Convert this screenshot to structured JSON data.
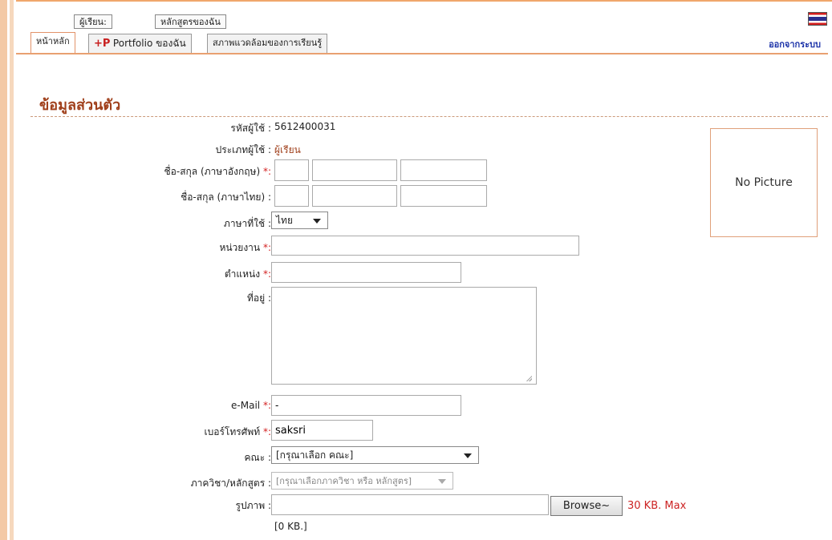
{
  "nav": {
    "learner_btn": "ผู้เรียน:",
    "my_courses_btn": "หลักสูตรของฉัน",
    "tabs": [
      {
        "label": "หน้าหลัก"
      },
      {
        "prefix": "+P",
        "label": "Portfolio ของฉัน"
      },
      {
        "label": "สภาพแวดล้อมของการเรียนรู้"
      }
    ],
    "logout": "ออกจากระบบ"
  },
  "section_title": "ข้อมูลส่วนตัว",
  "form": {
    "user_id_label": "รหัสผู้ใช้ :",
    "user_id_value": "5612400031",
    "user_type_label": "ประเภทผู้ใช้ :",
    "user_type_value": "ผู้เรียน",
    "name_en_label": "ชื่อ-สกุล (ภาษาอังกฤษ)",
    "name_th_label": "ชื่อ-สกุล (ภาษาไทย) :",
    "language_label": "ภาษาที่ใช้ :",
    "language_value": "ไทย",
    "org_label": "หน่วยงาน",
    "position_label": "ตำแหน่ง",
    "address_label": "ที่อยู่ :",
    "email_label": "e-Mail",
    "email_value": "-",
    "phone_label": "เบอร์โทรศัพท์",
    "phone_value": "saksri",
    "faculty_label": "คณะ :",
    "faculty_value": "[กรุณาเลือก คณะ]",
    "dept_label": "ภาควิชา/หลักสูตร :",
    "dept_value": "[กรุณาเลือกภาควิชา หรือ หลักสูตร]",
    "photo_label": "รูปภาพ :",
    "browse_label": "Browse~",
    "max_size": "30 KB. Max",
    "file_size": "[0 KB.]",
    "required_mark": "*:"
  },
  "picture_placeholder": "No Picture",
  "colors": {
    "accent": "#a0401c",
    "required": "#d21e1e",
    "logout": "#1b32a8",
    "border": "#e9a071"
  }
}
